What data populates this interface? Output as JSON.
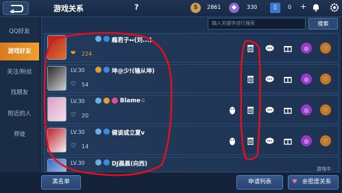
{
  "header": {
    "title": "游戏关系",
    "help": "?",
    "gold": "2861",
    "diamond": "330",
    "voucher": "0",
    "plus": "+"
  },
  "sidebar": {
    "items": [
      {
        "label": "QQ好友"
      },
      {
        "label": "游戏好友"
      },
      {
        "label": "关注/粉丝"
      },
      {
        "label": "找朋友"
      },
      {
        "label": "附近的人"
      },
      {
        "label": "师徒"
      }
    ]
  },
  "search": {
    "placeholder": "输入关键字进行搜索",
    "button": "搜索"
  },
  "friends": [
    {
      "level": "",
      "name": "瘾君子↔(刘...)",
      "gender": "male",
      "score": "224",
      "score_gold": true
    },
    {
      "level": "LV.30",
      "name": "坤@少!(输从坤)",
      "gender": "male",
      "score": "54",
      "score_gold": false
    },
    {
      "level": "LV.30",
      "name": "Blame☆",
      "gender": "female",
      "score": "20",
      "score_gold": false
    },
    {
      "level": "LV.30",
      "name": "健谈或立夏v",
      "gender": "male",
      "score": "14",
      "score_gold": false
    },
    {
      "level": "LV.30",
      "name": "DJ晨晨(向西)",
      "gender": "male",
      "score": "",
      "score_gold": false,
      "status": "游戏中"
    }
  ],
  "footer": {
    "blacklist": "黑名单",
    "requests": "申请列表",
    "intimacy": "亲密度关系"
  },
  "colors": {
    "accent": "#f0a030",
    "annotation": "#e0101c"
  }
}
